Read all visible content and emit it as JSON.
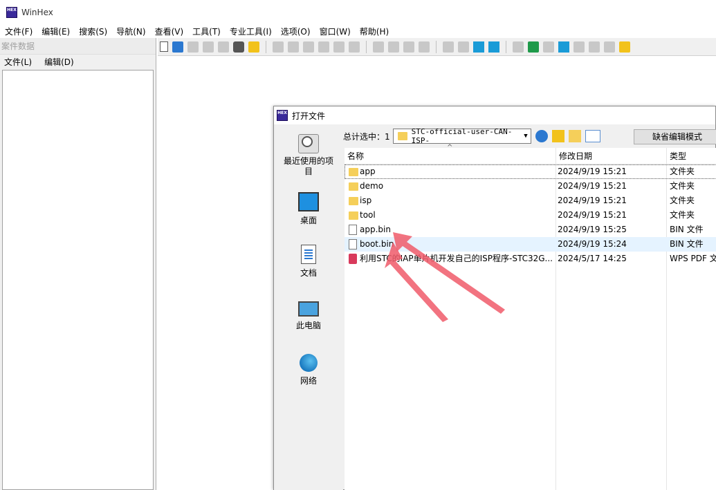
{
  "app": {
    "title": "WinHex",
    "logo_text": "HEX"
  },
  "menubar": [
    "文件(F)",
    "编辑(E)",
    "搜索(S)",
    "导航(N)",
    "查看(V)",
    "工具(T)",
    "专业工具(I)",
    "选项(O)",
    "窗口(W)",
    "帮助(H)"
  ],
  "left_panel": {
    "title": "案件数据",
    "menu": [
      "文件(L)",
      "编辑(D)"
    ]
  },
  "dialog": {
    "title": "打开文件",
    "places": [
      "最近使用的项目",
      "桌面",
      "文档",
      "此电脑",
      "网络"
    ],
    "look_in_label": "总计选中：1",
    "look_in_value": "STC-official-user-CAN-ISP-",
    "mode_button": "缺省编辑模式",
    "columns": [
      "名称",
      "修改日期",
      "类型"
    ],
    "files": [
      {
        "name": "app",
        "date": "2024/9/19 15:21",
        "type": "文件夹",
        "kind": "folder"
      },
      {
        "name": "demo",
        "date": "2024/9/19 15:21",
        "type": "文件夹",
        "kind": "folder"
      },
      {
        "name": "isp",
        "date": "2024/9/19 15:21",
        "type": "文件夹",
        "kind": "folder"
      },
      {
        "name": "tool",
        "date": "2024/9/19 15:21",
        "type": "文件夹",
        "kind": "folder"
      },
      {
        "name": "app.bin",
        "date": "2024/9/19 15:25",
        "type": "BIN 文件",
        "kind": "file"
      },
      {
        "name": "boot.bin",
        "date": "2024/9/19 15:24",
        "type": "BIN 文件",
        "kind": "file"
      },
      {
        "name": "利用STC的IAP单片机开发自己的ISP程序-STC32G...",
        "date": "2024/5/17 14:25",
        "type": "WPS PDF 文",
        "kind": "pdf"
      }
    ]
  },
  "colors": {
    "accent": "#2b78d0",
    "folder": "#f5cf5a",
    "selection": "#e5f3ff",
    "annotation": "#f05a6a"
  }
}
